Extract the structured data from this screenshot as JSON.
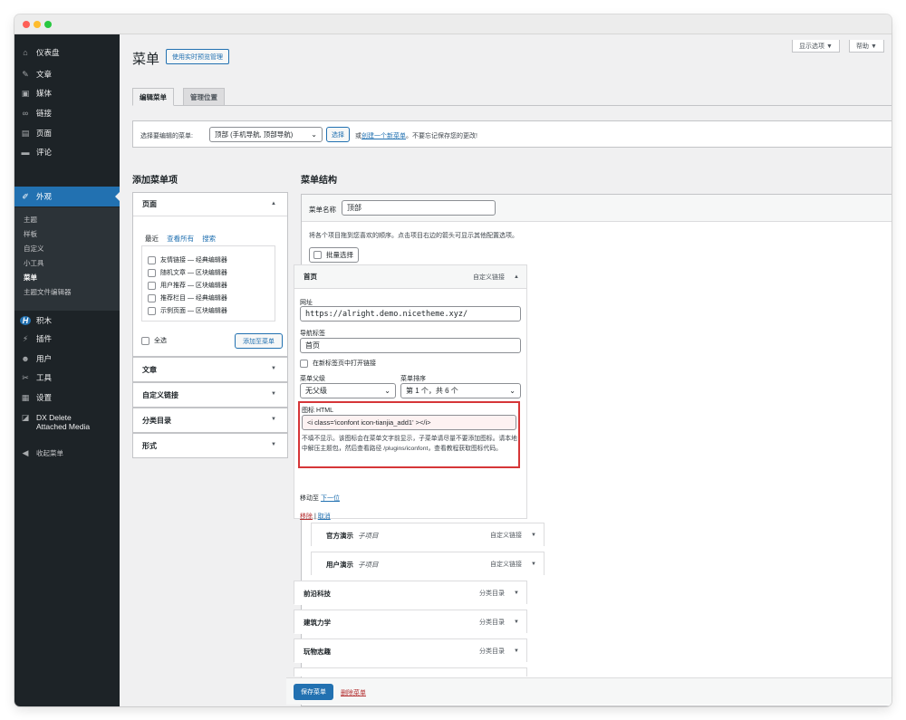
{
  "sidebar": {
    "items": [
      {
        "label": "仪表盘",
        "icon": "dashboard-icon",
        "glyph": "⌂"
      },
      {
        "label": "文章",
        "icon": "pin-icon",
        "glyph": "✎"
      },
      {
        "label": "媒体",
        "icon": "media-icon",
        "glyph": "▣"
      },
      {
        "label": "链接",
        "icon": "link-icon",
        "glyph": "∞"
      },
      {
        "label": "页面",
        "icon": "page-icon",
        "glyph": "▤"
      },
      {
        "label": "评论",
        "icon": "comment-icon",
        "glyph": "▬"
      },
      {
        "label": "外观",
        "icon": "brush-icon",
        "glyph": "✐"
      },
      {
        "label": "积木",
        "icon": "blocks-icon",
        "glyph": "H"
      },
      {
        "label": "插件",
        "icon": "plugin-icon",
        "glyph": "⚡"
      },
      {
        "label": "用户",
        "icon": "user-icon",
        "glyph": "☻"
      },
      {
        "label": "工具",
        "icon": "wrench-icon",
        "glyph": "✂"
      },
      {
        "label": "设置",
        "icon": "settings-icon",
        "glyph": "▦"
      },
      {
        "label": "DX Delete",
        "label2": "Attached Media",
        "icon": "media-delete-icon",
        "glyph": "◪"
      },
      {
        "label": "收起菜单",
        "icon": "collapse-icon",
        "glyph": "◀"
      }
    ],
    "submenu": [
      "主题",
      "样板",
      "自定义",
      "小工具",
      "菜单",
      "主题文件编辑器"
    ]
  },
  "header": {
    "title": "菜单",
    "preview_button": "使用实时预览管理",
    "screen_options": "显示选项 ▼",
    "help": "帮助 ▼"
  },
  "tabs": [
    "编辑菜单",
    "管理位置"
  ],
  "select_bar": {
    "label": "选择要编辑的菜单:",
    "selected": "顶部 (手机导航, 顶部导航)",
    "select_button": "选择",
    "hint_prefix": "或",
    "hint_link": "创建一个新菜单",
    "hint_suffix": "。不要忘记保存您的更改!"
  },
  "add_items": {
    "heading": "添加菜单项",
    "pages_panel": {
      "title": "页面",
      "subtabs": [
        "最近",
        "查看所有",
        "搜索"
      ],
      "items": [
        "友情链接 — 经典编辑器",
        "随机文章 — 区块编辑器",
        "用户推荐 — 区块编辑器",
        "推荐栏目 — 经典编辑器",
        "示例页面 — 区块编辑器"
      ],
      "select_all": "全选",
      "add_button": "添加至菜单"
    },
    "panels": [
      "文章",
      "自定义链接",
      "分类目录",
      "形式"
    ]
  },
  "structure": {
    "heading": "菜单结构",
    "name_label": "菜单名称",
    "name_value": "顶部",
    "instructions": "将各个项目拖到您喜欢的顺序。点击项目右边的箭头可显示其他配置选项。",
    "bulk_select": "批量选择",
    "expanded_item": {
      "title": "首页",
      "type": "自定义链接",
      "url_label": "网址",
      "url_value": "https://alright.demo.nicetheme.xyz/",
      "nav_label": "导航标签",
      "nav_value": "首页",
      "new_tab": "在新标签页中打开链接",
      "parent_label": "菜单父级",
      "parent_value": "无父级",
      "order_label": "菜单排序",
      "order_value": "第 1 个，共 6 个",
      "icon_label": "图标 HTML",
      "icon_value": "<i class='iconfont icon-tianjia_add1' ></i>",
      "icon_help": "不填不显示。该图标会在菜单文字前显示，子菜单请尽量不要添加图标。请本地中解压主题包，然后查看路径 /plugins/iconfont，查看教程获取图标代码。",
      "move_label": "移动至",
      "move_link": "下一位",
      "remove": "移除",
      "separator": "|",
      "cancel": "取消"
    },
    "items": [
      {
        "title": "官方演示",
        "sub": "子项目",
        "type": "自定义链接"
      },
      {
        "title": "用户演示",
        "sub": "子项目",
        "type": "自定义链接"
      },
      {
        "title": "前沿科技",
        "sub": "",
        "type": "分类目录"
      },
      {
        "title": "建筑力学",
        "sub": "",
        "type": "分类目录"
      },
      {
        "title": "玩物志趣",
        "sub": "",
        "type": "分类目录"
      }
    ],
    "save_button": "保存菜单",
    "delete_link": "删除菜单"
  }
}
